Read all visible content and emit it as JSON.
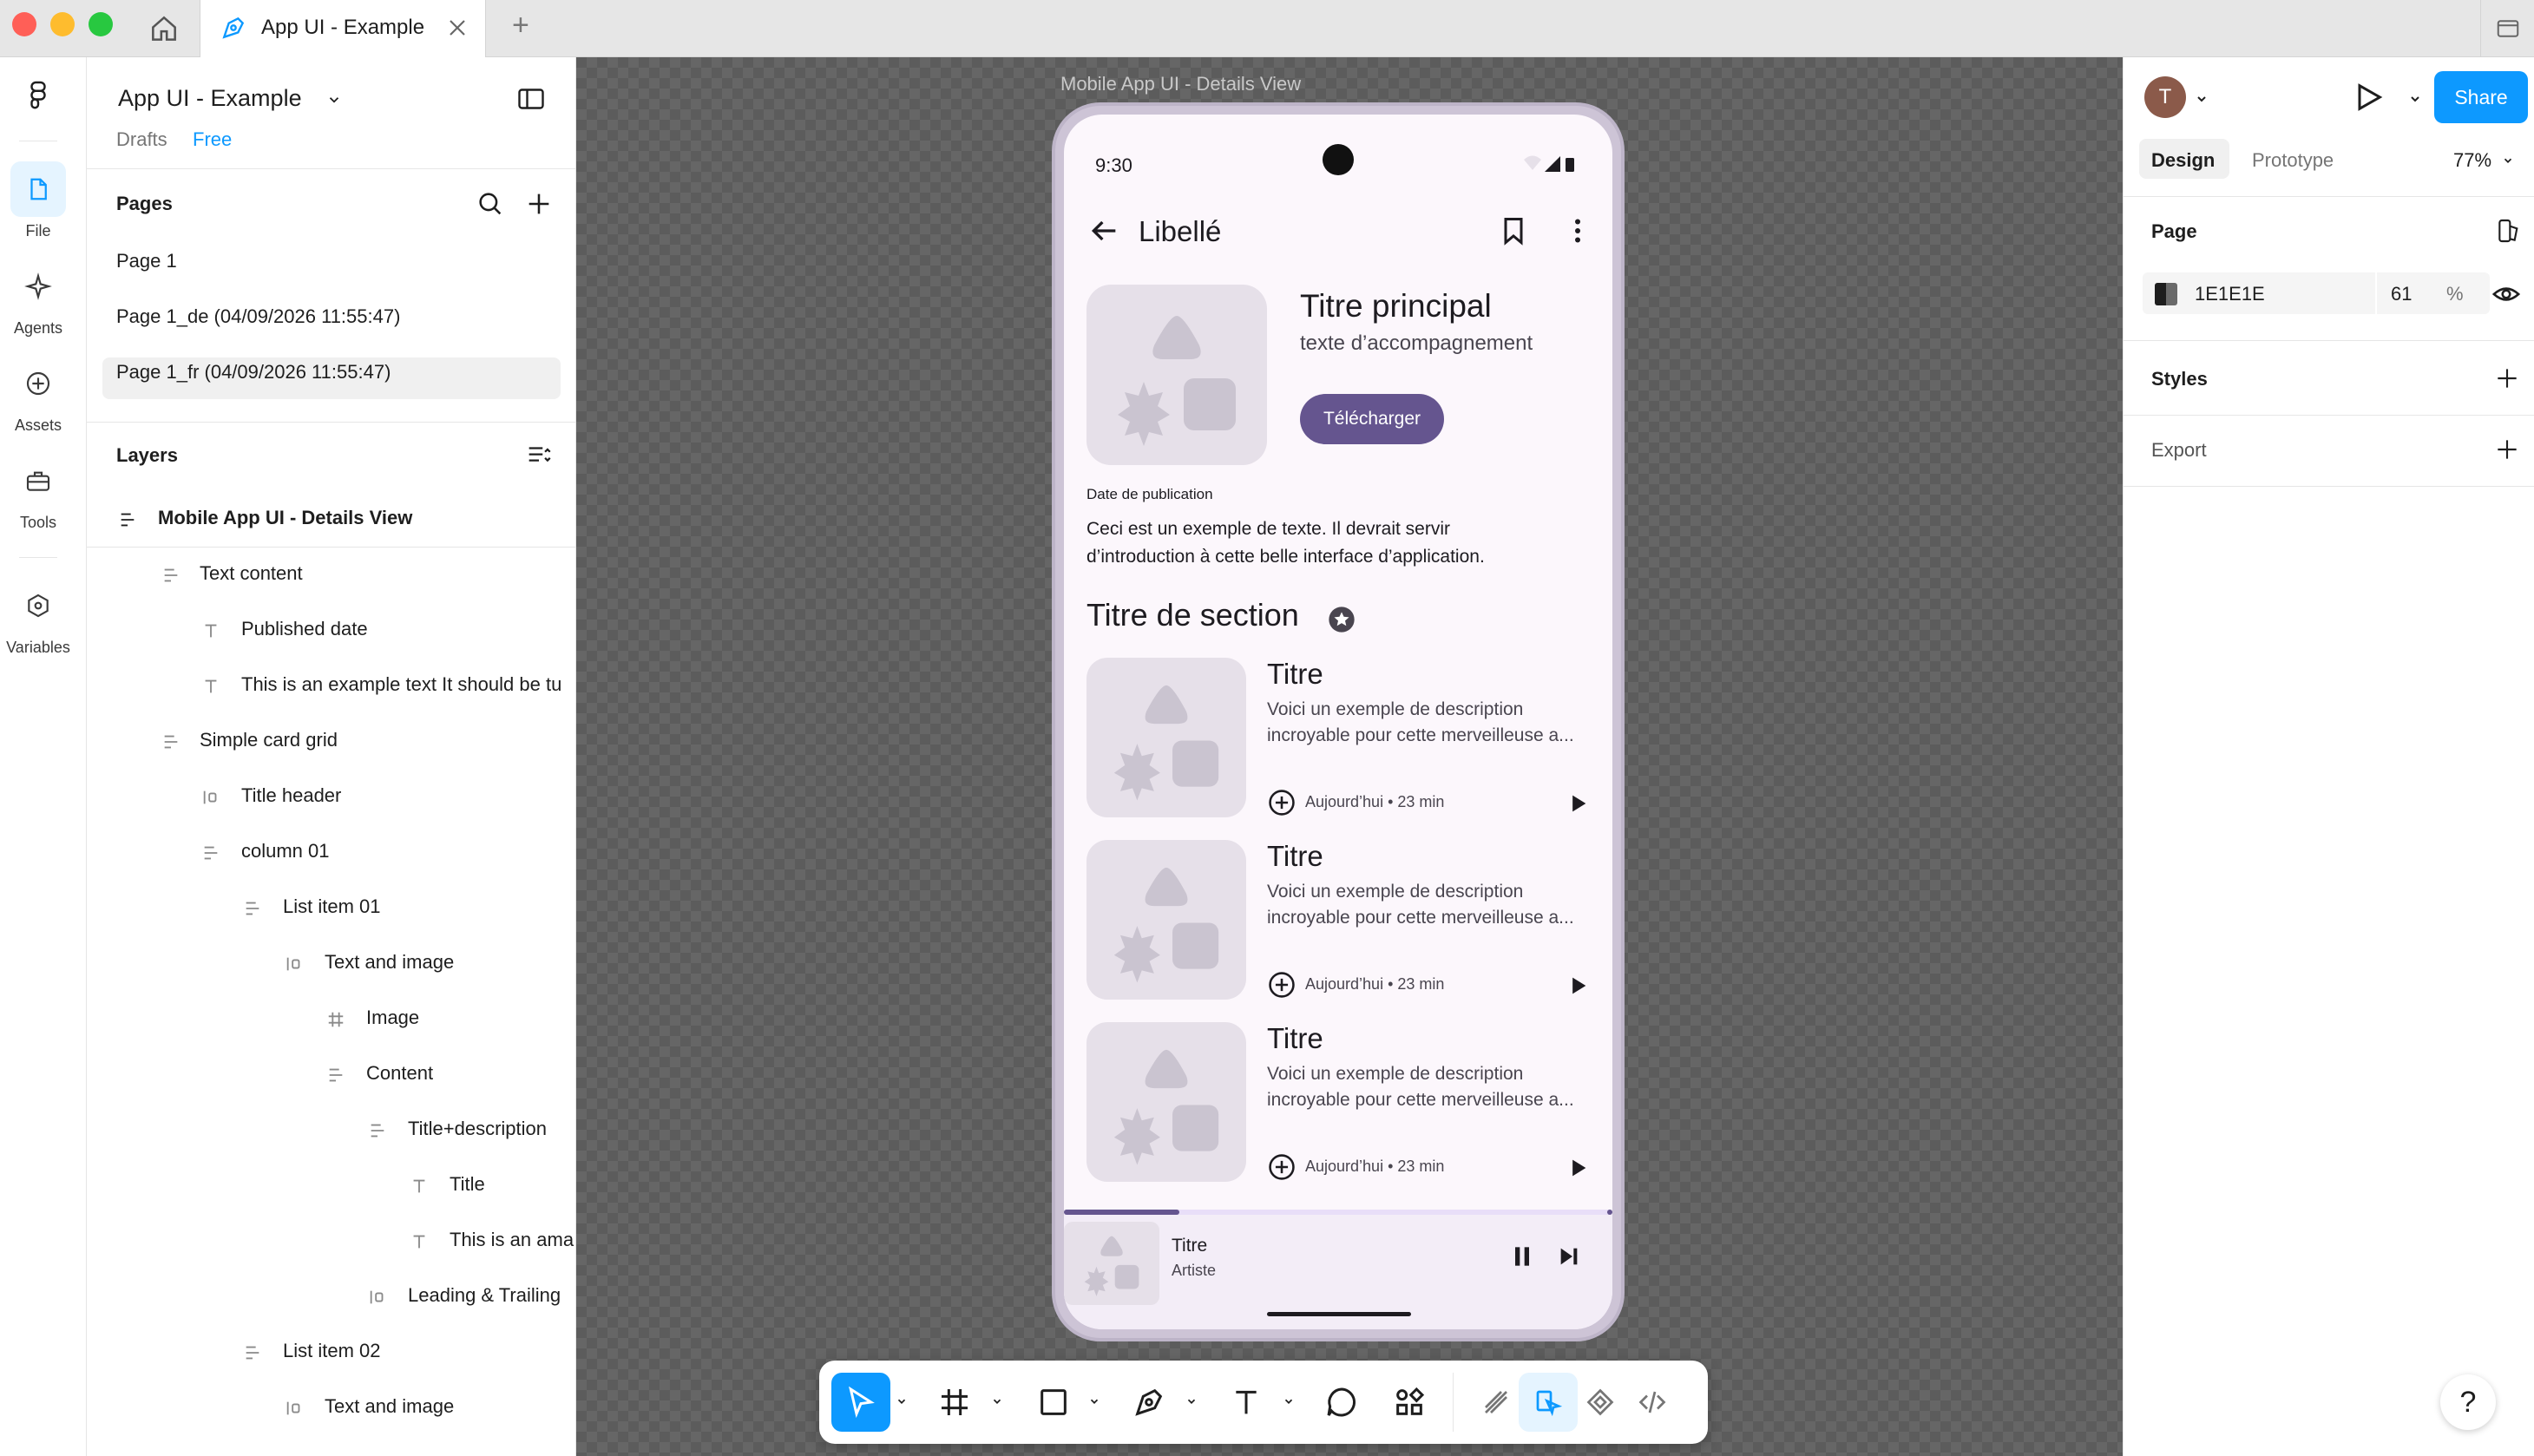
{
  "browser": {
    "tab_title": "App UI - Example",
    "new_tab": "+"
  },
  "rail": {
    "items": [
      {
        "label": "File"
      },
      {
        "label": "Agents"
      },
      {
        "label": "Assets"
      },
      {
        "label": "Tools"
      },
      {
        "label": "Variables"
      }
    ]
  },
  "file": {
    "name": "App UI - Example",
    "location": "Drafts",
    "plan": "Free"
  },
  "pages": {
    "heading": "Pages",
    "items": [
      {
        "label": "Page 1"
      },
      {
        "label": "Page 1_de (04/09/2026 11:55:47)"
      },
      {
        "label": "Page 1_fr (04/09/2026 11:55:47)"
      }
    ]
  },
  "layers": {
    "heading": "Layers",
    "items": [
      {
        "label": "Mobile App UI - Details View"
      },
      {
        "label": "Text content"
      },
      {
        "label": "Published date"
      },
      {
        "label": "This is an example text It should be tu"
      },
      {
        "label": "Simple card grid"
      },
      {
        "label": "Title header"
      },
      {
        "label": "column 01"
      },
      {
        "label": "List item 01"
      },
      {
        "label": "Text and image"
      },
      {
        "label": "Image"
      },
      {
        "label": "Content"
      },
      {
        "label": "Title+description"
      },
      {
        "label": "Title"
      },
      {
        "label": "This is an ama"
      },
      {
        "label": "Leading & Trailing"
      },
      {
        "label": "List item 02"
      },
      {
        "label": "Text and image"
      }
    ]
  },
  "canvas": {
    "frame_label": "Mobile App UI - Details View"
  },
  "phone": {
    "time": "9:30",
    "app_bar_title": "Libellé",
    "hero_title": "Titre principal",
    "hero_subtitle": "texte d’accompagnement",
    "download_button": "Télécharger",
    "date_label": "Date de publication",
    "body_line1": "Ceci est un exemple de texte. Il devrait servir",
    "body_line2": "d’introduction à cette belle interface d’application.",
    "section_title": "Titre de section",
    "cards": [
      {
        "title": "Titre",
        "desc1": "Voici un exemple de description",
        "desc2": "incroyable pour cette merveilleuse a...",
        "meta": "Aujourd’hui • 23 min"
      },
      {
        "title": "Titre",
        "desc1": "Voici un exemple de description",
        "desc2": "incroyable pour cette merveilleuse a...",
        "meta": "Aujourd’hui • 23 min"
      },
      {
        "title": "Titre",
        "desc1": "Voici un exemple de description",
        "desc2": "incroyable pour cette merveilleuse a...",
        "meta": "Aujourd’hui • 23 min"
      }
    ],
    "player": {
      "title": "Titre",
      "artist": "Artiste",
      "progress": 0.21
    }
  },
  "right": {
    "avatar_initial": "T",
    "share_label": "Share",
    "tab_design": "Design",
    "tab_prototype": "Prototype",
    "zoom": "77%",
    "page_heading": "Page",
    "page_color_hex": "1E1E1E",
    "page_color_opacity": "61",
    "percent_sign": "%",
    "styles_heading": "Styles",
    "export_heading": "Export"
  },
  "help": "?",
  "colors": {
    "accent_blue": "#0d99ff",
    "phone_primary": "#65558f",
    "phone_surface": "#fcf7fc"
  }
}
